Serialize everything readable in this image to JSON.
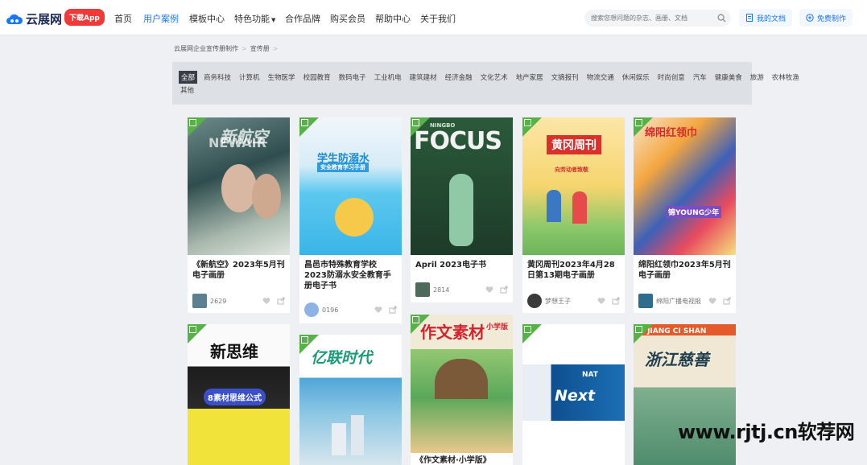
{
  "header": {
    "logo_text": "云展网",
    "app_badge": "下载App",
    "menu": [
      "首页",
      "用户案例",
      "模板中心",
      "特色功能",
      "合作品牌",
      "购买会员",
      "帮助中心",
      "关于我们"
    ],
    "search_placeholder": "搜索您想问题的杂志、画册、文档",
    "my_docs": "我的文档",
    "free_make": "免费制作"
  },
  "breadcrumb": [
    "云展网企业宣传册制作",
    "宣传册"
  ],
  "categories_row1": [
    "全部",
    "商务科技",
    "计算机",
    "生物医学",
    "校园教育",
    "数码电子",
    "工业机电",
    "建筑建材",
    "经济金融",
    "文化艺术",
    "地产家居",
    "文摘报刊",
    "物流交通",
    "休闲娱乐",
    "时尚创意",
    "汽车",
    "健康美食",
    "旅游",
    "农林牧渔"
  ],
  "categories_row2": [
    "其他"
  ],
  "cards": [
    {
      "title": "《新航空》2023年5月刊电子画册",
      "views": "2629",
      "cover_text": "新航空",
      "cover_sub": "NEWAIR"
    },
    {
      "title": "昌邑市特殊教育学校2023防溺水安全教育手册电子书",
      "views": "0196",
      "cover_text": "学生防溺水",
      "cover_sub": "安全教育学习手册"
    },
    {
      "title": "April 2023电子书",
      "views": "2814",
      "cover_text": "FOCUS",
      "cover_sub": "NINGBO"
    },
    {
      "title": "黄冈周刊2023年4月28日第13期电子画册",
      "views": "梦想王子",
      "cover_text": "黄冈周刊",
      "cover_sub": "向劳动者致敬"
    },
    {
      "title": "绵阳红领巾2023年5月刊电子画册",
      "views": "绵阳广播电视报",
      "cover_text": "绵阳红领巾",
      "cover_sub": "锦YOUNG少年"
    },
    {
      "title": "",
      "views": "",
      "cover_text": "新思维",
      "cover_sub": "8素材思维公式"
    },
    {
      "title": "",
      "views": "",
      "cover_text": "亿联时代",
      "cover_sub": ""
    },
    {
      "title": "《作文素材·小学版》",
      "views": "",
      "cover_text": "作文素材",
      "cover_sub": "小学版"
    },
    {
      "title": "",
      "views": "",
      "cover_text": "Next",
      "cover_sub": "NAT"
    },
    {
      "title": "",
      "views": "",
      "cover_text": "浙江慈善",
      "cover_sub": "CI JIANG CI SHAN"
    }
  ],
  "watermark": "www.rjtj.cn软荐网",
  "colors": {
    "accent": "#1677ff",
    "badge": "#f03a3a",
    "qr": "#56b247"
  }
}
